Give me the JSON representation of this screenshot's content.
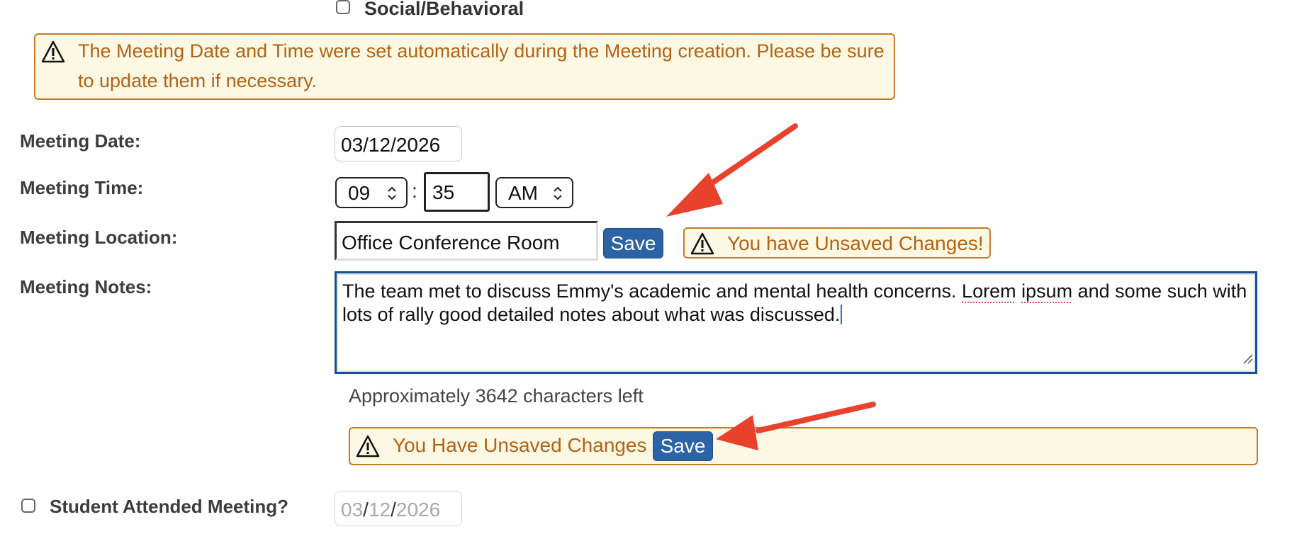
{
  "top_checkbox": {
    "label": "Social/Behavioral",
    "checked": false
  },
  "info_alert": {
    "text": "The Meeting Date and Time were set automatically during the Meeting creation. Please be sure to update them if necessary.",
    "icon": "warning-triangle-icon"
  },
  "fields": {
    "date_label": "Meeting Date:",
    "date_value": "03/12/2026",
    "time_label": "Meeting Time:",
    "hour_value": "09",
    "time_separator": ":",
    "minute_value": "35",
    "ampm_value": "AM",
    "location_label": "Meeting Location:",
    "location_value": "Office Conference Room",
    "location_save": "Save",
    "unsaved_badge": "You have Unsaved Changes!",
    "notes_label": "Meeting Notes:",
    "notes_value_part1": "The team met to discuss Emmy's academic and mental health concerns. ",
    "notes_spell_1": "Lorem",
    "notes_space": " ",
    "notes_spell_2": "ipsum",
    "notes_value_part2": " and some such with lots of rally good detailed notes about what was discussed.",
    "chars_left": "Approximately 3642 characters left"
  },
  "bottom_alert": {
    "text": "You Have Unsaved Changes",
    "save": "Save"
  },
  "student_attended": {
    "label": "Student Attended Meeting?",
    "checked": false,
    "date_month": "03",
    "date_sep1": "/",
    "date_day": "12",
    "date_sep2": "/",
    "date_year": "2026"
  },
  "colors": {
    "warning_border": "#c47a2c",
    "warning_bg": "#fcf8e3",
    "warning_text": "#b26315",
    "button_blue": "#2b63a4",
    "annotation_arrow": "#e8412c"
  }
}
